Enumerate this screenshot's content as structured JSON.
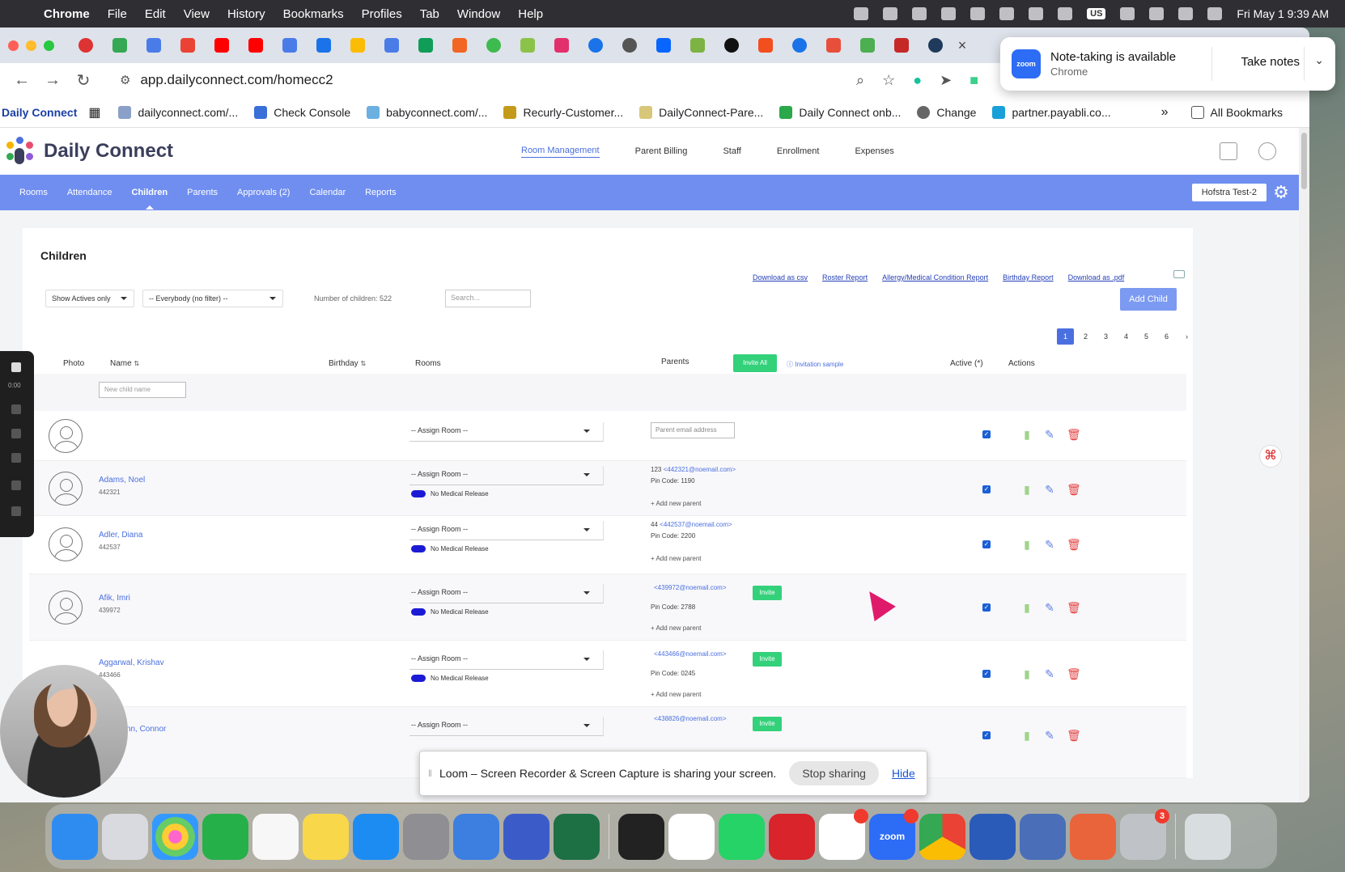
{
  "menubar": {
    "app": "Chrome",
    "items": [
      "File",
      "Edit",
      "View",
      "History",
      "Bookmarks",
      "Profiles",
      "Tab",
      "Window",
      "Help"
    ],
    "ime": "US",
    "clock": "Fri May 1  9:39 AM"
  },
  "browser": {
    "url": "app.dailyconnect.com/homecc2",
    "bookmarks": [
      {
        "label": "Daily Connect",
        "color": "#1a3fa5"
      },
      {
        "label": "dailyconnect.com/...",
        "color": "#8aa0c8"
      },
      {
        "label": "Check Console",
        "color": "#3b6fd8"
      },
      {
        "label": "babyconnect.com/...",
        "color": "#6bb0e0"
      },
      {
        "label": "Recurly-Customer...",
        "color": "#c49a1a"
      },
      {
        "label": "DailyConnect-Pare...",
        "color": "#d8c77a"
      },
      {
        "label": "Daily Connect onb...",
        "color": "#2aa84a"
      },
      {
        "label": "Change",
        "color": "#666"
      },
      {
        "label": "partner.payabli.co...",
        "color": "#19a0d8"
      }
    ],
    "all_bookmarks": "All Bookmarks"
  },
  "zoom_notice": {
    "logo": "zoom",
    "title": "Note-taking is available",
    "subtitle": "Chrome",
    "action": "Take notes"
  },
  "app": {
    "name": "Daily Connect",
    "topnav": [
      "Room Management",
      "Parent Billing",
      "Staff",
      "Enrollment",
      "Expenses"
    ],
    "subnav": [
      "Rooms",
      "Attendance",
      "Children",
      "Parents",
      "Approvals (2)",
      "Calendar",
      "Reports"
    ],
    "school": "Hofstra Test-2"
  },
  "children": {
    "title": "Children",
    "downloads": [
      "Download as csv",
      "Roster Report",
      "Allergy/Medical Condition Report",
      "Birthday Report",
      "Download as .pdf"
    ],
    "add_child": "Add Child",
    "filter_active": "Show Actives only",
    "filter_group": "-- Everybody (no filter) --",
    "count_label": "Number of children: 522",
    "search_placeholder": "Search...",
    "pages": [
      "1",
      "2",
      "3",
      "4",
      "5",
      "6",
      "›"
    ],
    "headers": {
      "photo": "Photo",
      "name": "Name",
      "birthday": "Birthday",
      "rooms": "Rooms",
      "parents": "Parents",
      "invite_all": "Invite All",
      "invitation_sample": "Invitation sample",
      "active": "Active (*)",
      "actions": "Actions"
    },
    "new_child_placeholder": "New child name",
    "assign_room": "-- Assign Room --",
    "parent_email_placeholder": "Parent email address",
    "no_medical": "No Medical Release",
    "add_parent": "+ Add new parent",
    "invite": "Invite",
    "rows": [
      {
        "name": "Adams, Noel",
        "id": "442321",
        "parent_prefix": "123",
        "email": "<442321@noemail.com>",
        "pin": "Pin Code: 1190",
        "invite": false
      },
      {
        "name": "Adler, Diana",
        "id": "442537",
        "parent_prefix": "44",
        "email": "<442537@noemail.com>",
        "pin": "Pin Code: 2200",
        "invite": false
      },
      {
        "name": "Afik, Imri",
        "id": "439972",
        "parent_prefix": "",
        "email": "<439972@noemail.com>",
        "pin": "Pin Code: 2788",
        "invite": true
      },
      {
        "name": "Aggarwal, Krishav",
        "id": "443466",
        "parent_prefix": "",
        "email": "<443466@noemail.com>",
        "pin": "Pin Code: 0245",
        "invite": true
      },
      {
        "name": "Ahlemann, Connor",
        "id": "438826",
        "parent_prefix": "",
        "email": "<438826@noemail.com>",
        "pin": "",
        "invite": true
      }
    ]
  },
  "loom": {
    "timer": "0:00",
    "message": "Loom – Screen Recorder & Screen Capture is sharing your screen.",
    "stop": "Stop sharing",
    "hide": "Hide"
  },
  "dock": [
    {
      "name": "finder",
      "color": "#2e8cf0"
    },
    {
      "name": "launchpad",
      "color": "#d9d9e0"
    },
    {
      "name": "photos",
      "color": "#f4f4f4"
    },
    {
      "name": "numbers",
      "color": "#26b04a"
    },
    {
      "name": "reminders",
      "color": "#f7f7f7"
    },
    {
      "name": "notes",
      "color": "#f8d84a"
    },
    {
      "name": "app-store",
      "color": "#1d8cf2"
    },
    {
      "name": "system-settings",
      "color": "#8e8e93"
    },
    {
      "name": "remote-desktop",
      "color": "#3d7fe0"
    },
    {
      "name": "simulator",
      "color": "#3b5cc8"
    },
    {
      "name": "excel",
      "color": "#1d7044"
    },
    {
      "name": "launcher",
      "color": "#222"
    },
    {
      "name": "asana",
      "color": "#fff"
    },
    {
      "name": "whatsapp",
      "color": "#25d366"
    },
    {
      "name": "acrobat",
      "color": "#d8242a"
    },
    {
      "name": "slack",
      "color": "#fff"
    },
    {
      "name": "zoom",
      "color": "#2d6cf5",
      "label": "zoom"
    },
    {
      "name": "chrome",
      "color": "#fff"
    },
    {
      "name": "word",
      "color": "#2b5bb8"
    },
    {
      "name": "vpn",
      "color": "#4a6fb8"
    },
    {
      "name": "claude",
      "color": "#e9643b"
    },
    {
      "name": "printer",
      "color": "#bfc3c7",
      "badge": "3"
    },
    {
      "name": "trash",
      "color": "#d8dde0"
    }
  ]
}
